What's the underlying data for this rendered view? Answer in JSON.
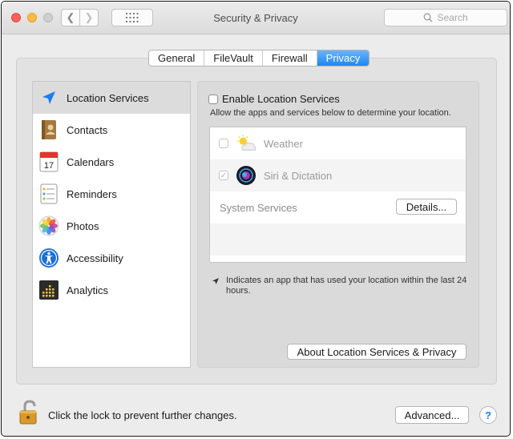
{
  "window": {
    "title": "Security & Privacy"
  },
  "search": {
    "placeholder": "Search"
  },
  "tabs": [
    {
      "label": "General",
      "active": false
    },
    {
      "label": "FileVault",
      "active": false
    },
    {
      "label": "Firewall",
      "active": false
    },
    {
      "label": "Privacy",
      "active": true
    }
  ],
  "sidebar": {
    "items": [
      {
        "label": "Location Services",
        "icon": "location-arrow-icon",
        "selected": true
      },
      {
        "label": "Contacts",
        "icon": "contacts-book-icon"
      },
      {
        "label": "Calendars",
        "icon": "calendar-icon"
      },
      {
        "label": "Reminders",
        "icon": "reminders-list-icon"
      },
      {
        "label": "Photos",
        "icon": "photos-flower-icon"
      },
      {
        "label": "Accessibility",
        "icon": "accessibility-person-icon"
      },
      {
        "label": "Analytics",
        "icon": "analytics-grid-icon"
      }
    ]
  },
  "location": {
    "enable_label": "Enable Location Services",
    "enable_checked": false,
    "allow_text": "Allow the apps and services below to determine your location.",
    "apps": [
      {
        "name": "Weather",
        "checked": false,
        "icon": "weather-sun-cloud-icon"
      },
      {
        "name": "Siri & Dictation",
        "checked": true,
        "icon": "siri-icon"
      }
    ],
    "system_services_label": "System Services",
    "details_button": "Details...",
    "note_text": "Indicates an app that has used your location within the last 24 hours.",
    "about_button": "About Location Services & Privacy"
  },
  "footer": {
    "lock_text": "Click the lock to prevent further changes.",
    "advanced_button": "Advanced...",
    "help_label": "?"
  },
  "colors": {
    "accent": "#1d87f2",
    "location_icon": "#1a7ef0"
  }
}
